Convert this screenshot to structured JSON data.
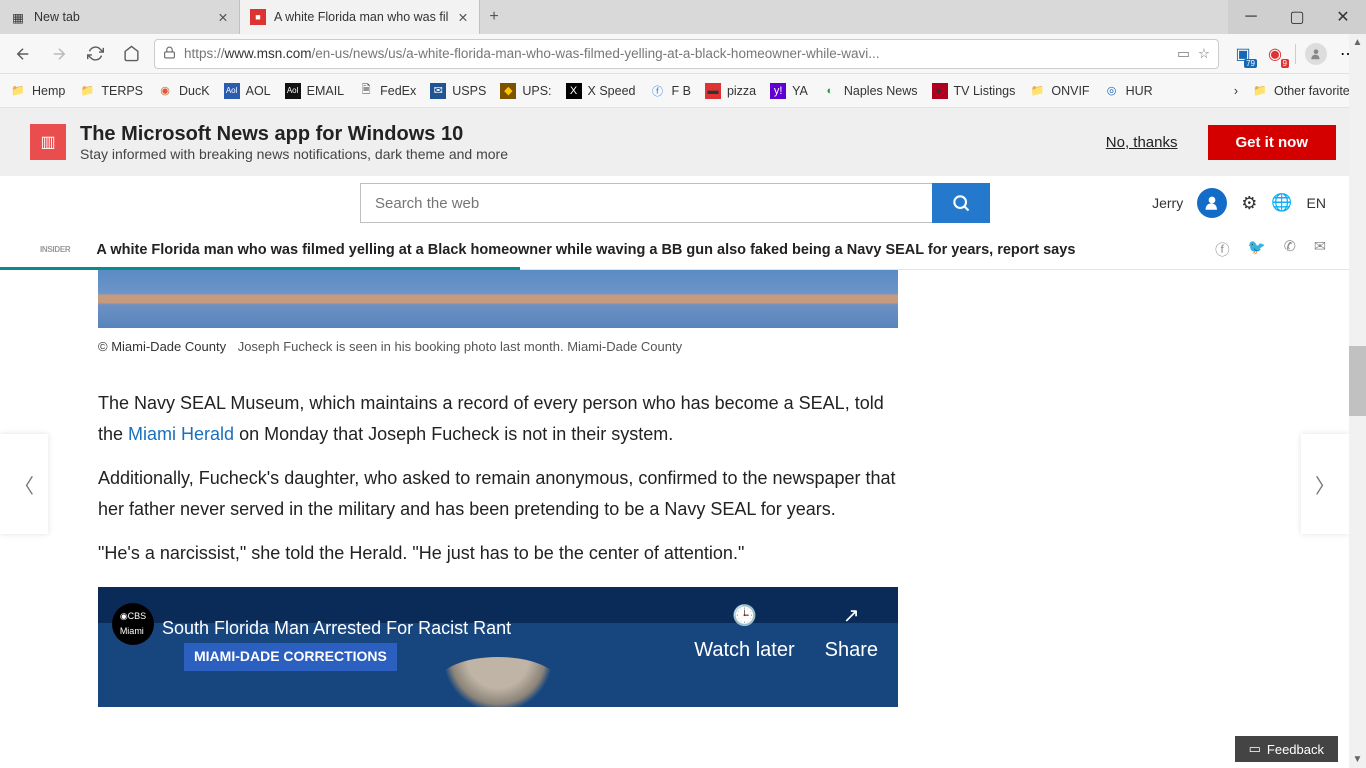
{
  "tabs": [
    {
      "title": "New tab",
      "active": false
    },
    {
      "title": "A white Florida man who was fil",
      "active": true
    }
  ],
  "url": {
    "prefix": "https://",
    "host": "www.msn.com",
    "path": "/en-us/news/us/a-white-florida-man-who-was-filmed-yelling-at-a-black-homeowner-while-wavi..."
  },
  "ext_badges": {
    "collections": "79",
    "abp": "9"
  },
  "bookmarks": [
    {
      "label": "Hemp",
      "icon": "folder"
    },
    {
      "label": "TERPS",
      "icon": "folder"
    },
    {
      "label": "DucK",
      "icon": "duck"
    },
    {
      "label": "AOL",
      "icon": "aol"
    },
    {
      "label": "EMAIL",
      "icon": "aol2"
    },
    {
      "label": "FedEx",
      "icon": "doc"
    },
    {
      "label": "USPS",
      "icon": "usps"
    },
    {
      "label": "UPS:",
      "icon": "ups"
    },
    {
      "label": "X Speed",
      "icon": "x"
    },
    {
      "label": "F B",
      "icon": "fb"
    },
    {
      "label": "pizza",
      "icon": "pizza"
    },
    {
      "label": "YA",
      "icon": "ya"
    },
    {
      "label": "Naples News",
      "icon": "nn"
    },
    {
      "label": "TV Listings",
      "icon": "tv"
    },
    {
      "label": "ONVIF",
      "icon": "folder"
    },
    {
      "label": "HUR",
      "icon": "hur"
    }
  ],
  "other_favorites": "Other favorites",
  "promo": {
    "title": "The Microsoft News app for Windows 10",
    "subtitle": "Stay informed with breaking news notifications, dark theme and more",
    "nothanks": "No, thanks",
    "get": "Get it now"
  },
  "search": {
    "placeholder": "Search the web"
  },
  "user": {
    "name": "Jerry",
    "lang": "EN"
  },
  "headline": {
    "source": "INSIDER",
    "text": "A white Florida man who was filmed yelling at a Black homeowner while waving a BB gun also faked being a Navy SEAL for years, report says"
  },
  "caption": {
    "source": "© Miami-Dade County",
    "text": "Joseph Fucheck is seen in his booking photo last month. Miami-Dade County"
  },
  "paragraphs": {
    "p1a": "The Navy SEAL Museum, which maintains a record of every person who has become a SEAL, told the ",
    "p1link": "Miami Herald",
    "p1b": " on Monday that Joseph Fucheck is not in their system.",
    "p2": "Additionally, Fucheck's daughter, who asked to remain anonymous, confirmed to the newspaper that her father never served in the military and has been pretending to be a Navy SEAL for years.",
    "p3": "\"He's a narcissist,\" she told the Herald. \"He just has to be the center of attention.\""
  },
  "video": {
    "logo": "CBS Miami",
    "title": "South Florida Man Arrested For Racist Rant",
    "tag": "MIAMI-DADE CORRECTIONS",
    "watch": "Watch later",
    "share": "Share"
  },
  "feedback": "Feedback"
}
